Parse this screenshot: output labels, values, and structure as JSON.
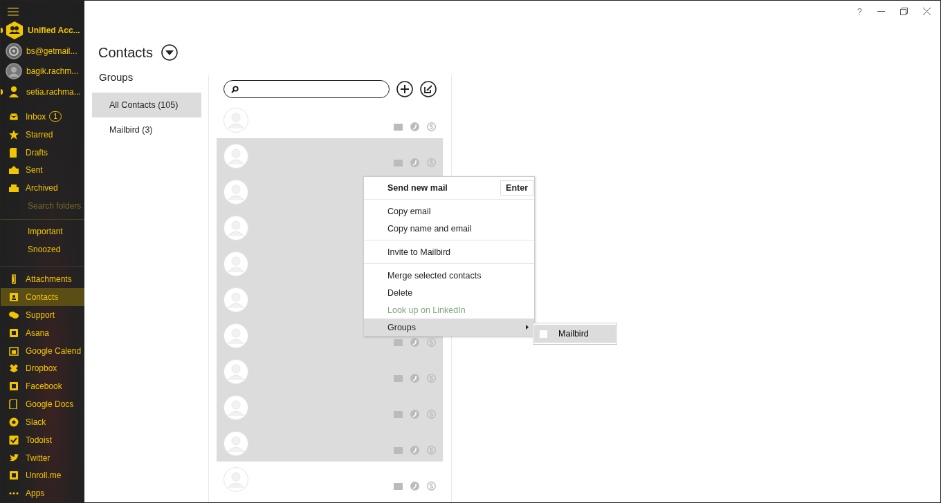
{
  "window": {
    "help": "?"
  },
  "sidebar": {
    "accounts": [
      {
        "name": "Unified Acc...",
        "kind": "unified",
        "selected": true,
        "indicator": true
      },
      {
        "name": "bs@getmail...",
        "kind": "swirl",
        "selected": false,
        "indicator": false
      },
      {
        "name": "bagik.rachm...",
        "kind": "photo",
        "selected": false,
        "indicator": false
      },
      {
        "name": "setia.rachma...",
        "kind": "person",
        "selected": false,
        "indicator": true
      }
    ],
    "folders": [
      {
        "label": "Inbox",
        "badge": "1"
      },
      {
        "label": "Starred"
      },
      {
        "label": "Drafts"
      },
      {
        "label": "Sent"
      },
      {
        "label": "Archived"
      }
    ],
    "search_folders": "Search folders",
    "smart_folders": [
      {
        "label": "Important"
      },
      {
        "label": "Snoozed"
      }
    ],
    "apps": [
      {
        "label": "Attachments",
        "selected": false
      },
      {
        "label": "Contacts",
        "selected": true
      },
      {
        "label": "Support",
        "selected": false
      },
      {
        "label": "Asana",
        "selected": false
      },
      {
        "label": "Google Calend",
        "selected": false
      },
      {
        "label": "Dropbox",
        "selected": false
      },
      {
        "label": "Facebook",
        "selected": false
      },
      {
        "label": "Google Docs",
        "selected": false
      },
      {
        "label": "Slack",
        "selected": false
      },
      {
        "label": "Todoist",
        "selected": false
      },
      {
        "label": "Twitter",
        "selected": false
      },
      {
        "label": "Unroll.me",
        "selected": false
      },
      {
        "label": "Apps",
        "selected": false
      }
    ]
  },
  "page": {
    "title": "Contacts"
  },
  "groups": {
    "title": "Groups",
    "items": [
      {
        "label": "All Contacts  (105)",
        "selected": true
      },
      {
        "label": "Mailbird  (3)",
        "selected": false
      }
    ]
  },
  "contacts": {
    "rows": [
      {
        "selected": false,
        "icons_visible": true
      },
      {
        "selected": true,
        "icons_visible": true
      },
      {
        "selected": true,
        "icons_visible": false
      },
      {
        "selected": true,
        "icons_visible": false
      },
      {
        "selected": true,
        "icons_visible": false
      },
      {
        "selected": true,
        "icons_visible": false
      },
      {
        "selected": true,
        "icons_visible": true
      },
      {
        "selected": true,
        "icons_visible": true
      },
      {
        "selected": true,
        "icons_visible": true
      },
      {
        "selected": true,
        "icons_visible": true
      },
      {
        "selected": false,
        "icons_visible": true
      }
    ]
  },
  "context_menu": {
    "sections": [
      [
        {
          "label": "Send new mail",
          "default": true,
          "shortcut": "Enter",
          "disabled": false,
          "highlighted": false,
          "submenu": false
        }
      ],
      [
        {
          "label": "Copy email",
          "default": false,
          "disabled": false,
          "highlighted": false,
          "submenu": false
        },
        {
          "label": "Copy name and email",
          "default": false,
          "disabled": false,
          "highlighted": false,
          "submenu": false
        }
      ],
      [
        {
          "label": "Invite to Mailbird",
          "default": false,
          "disabled": false,
          "highlighted": false,
          "submenu": false
        }
      ],
      [
        {
          "label": "Merge selected contacts",
          "default": false,
          "disabled": false,
          "highlighted": false,
          "submenu": false
        },
        {
          "label": "Delete",
          "default": false,
          "disabled": false,
          "highlighted": false,
          "submenu": false
        },
        {
          "label": "Look up on LinkedIn",
          "default": false,
          "disabled": true,
          "highlighted": false,
          "submenu": false
        },
        {
          "label": "Groups",
          "default": false,
          "disabled": false,
          "highlighted": true,
          "submenu": true
        }
      ]
    ],
    "submenu": [
      {
        "label": "Mailbird",
        "checked": false
      }
    ]
  }
}
